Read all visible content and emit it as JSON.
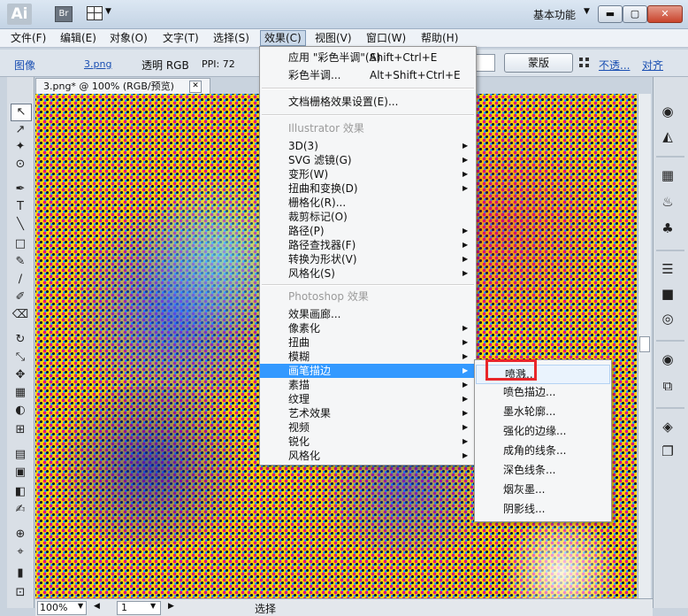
{
  "titlebar": {
    "logo": "Ai",
    "bridge_button": "Br",
    "workspace": "基本功能",
    "workspace_caret": "▼",
    "arrange_caret": "▼",
    "min_icon": "▬",
    "max_icon": "▢",
    "close_icon": "✕"
  },
  "menubar": {
    "items": [
      "文件(F)",
      "编辑(E)",
      "对象(O)",
      "文字(T)",
      "选择(S)",
      "效果(C)",
      "视图(V)",
      "窗口(W)",
      "帮助(H)"
    ]
  },
  "controlbar": {
    "image_label": "图像",
    "file_name": "3.png",
    "mode": "透明 RGB",
    "ppi": "PPI: 72",
    "mask_button": "蒙版",
    "opacity_link": "不透...",
    "align_link": "对齐"
  },
  "document": {
    "tab_title": "3.png* @ 100% (RGB/预览)",
    "close_icon": "✕"
  },
  "statusbar": {
    "zoom": "100%",
    "page": "1",
    "status": "选择",
    "prev_icon": "◀",
    "next_icon": "▶",
    "caret": "▼"
  },
  "effects_menu": {
    "apply_label": "应用 \"彩色半调\"(A)",
    "apply_shortcut": "Shift+Ctrl+E",
    "last_label": "彩色半调...",
    "last_shortcut": "Alt+Shift+Ctrl+E",
    "raster_settings": "文档栅格效果设置(E)...",
    "illustrator_header": "Illustrator 效果",
    "illustrator_items": [
      "3D(3)",
      "SVG 滤镜(G)",
      "变形(W)",
      "扭曲和变换(D)",
      "栅格化(R)...",
      "裁剪标记(O)",
      "路径(P)",
      "路径查找器(F)",
      "转换为形状(V)",
      "风格化(S)"
    ],
    "photoshop_header": "Photoshop 效果",
    "photoshop_items": [
      "效果画廊...",
      "像素化",
      "扭曲",
      "模糊",
      "画笔描边",
      "素描",
      "纹理",
      "艺术效果",
      "视频",
      "锐化",
      "风格化"
    ],
    "submenu_arrow": "▶"
  },
  "brush_strokes_submenu": {
    "items": [
      "喷溅...",
      "喷色描边...",
      "墨水轮廓...",
      "强化的边缘...",
      "成角的线条...",
      "深色线条...",
      "烟灰墨...",
      "阴影线..."
    ]
  },
  "tools": [
    "↖",
    "↗",
    "✦",
    "⊙",
    "✒",
    "T",
    "╲",
    "□",
    "✎",
    "∕",
    "✐",
    "⌫",
    "↻",
    "⤡",
    "✥",
    "▦",
    "◐",
    "⊞",
    "▤",
    "▣",
    "◧",
    "✍",
    "⊕",
    "⌖",
    "▮",
    "⊡",
    "✋"
  ],
  "right_icons": [
    "◉",
    "◭",
    "▦",
    "♨",
    "♣",
    "☰",
    "■",
    "◎",
    "◉",
    "⧉",
    "◈",
    "❐"
  ],
  "colors": {
    "menu_highlight": "#3399ff",
    "annotation_red": "#e8262b",
    "link_blue": "#1a4fb2"
  }
}
